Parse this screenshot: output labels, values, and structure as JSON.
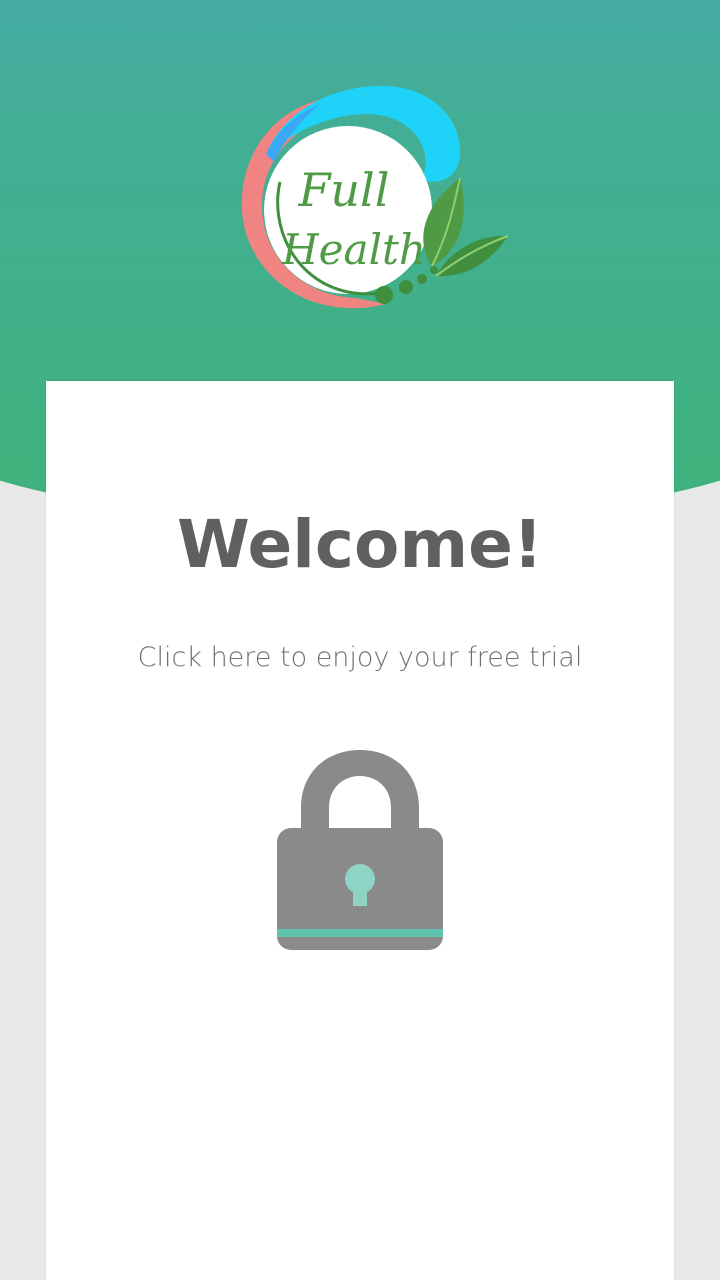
{
  "app": {
    "logo_line1": "Full",
    "logo_line2": "Health"
  },
  "card": {
    "title": "Welcome!",
    "trial_link": "Click here to enjoy your free trial",
    "lock_icon": "padlock-icon"
  },
  "colors": {
    "header_top": "#45a6c0",
    "header_bottom": "#3fb37a",
    "lock_body": "#8a8a8a",
    "lock_accent": "#5ec4b0",
    "keyhole": "#8fd3c5",
    "text": "#606060"
  }
}
